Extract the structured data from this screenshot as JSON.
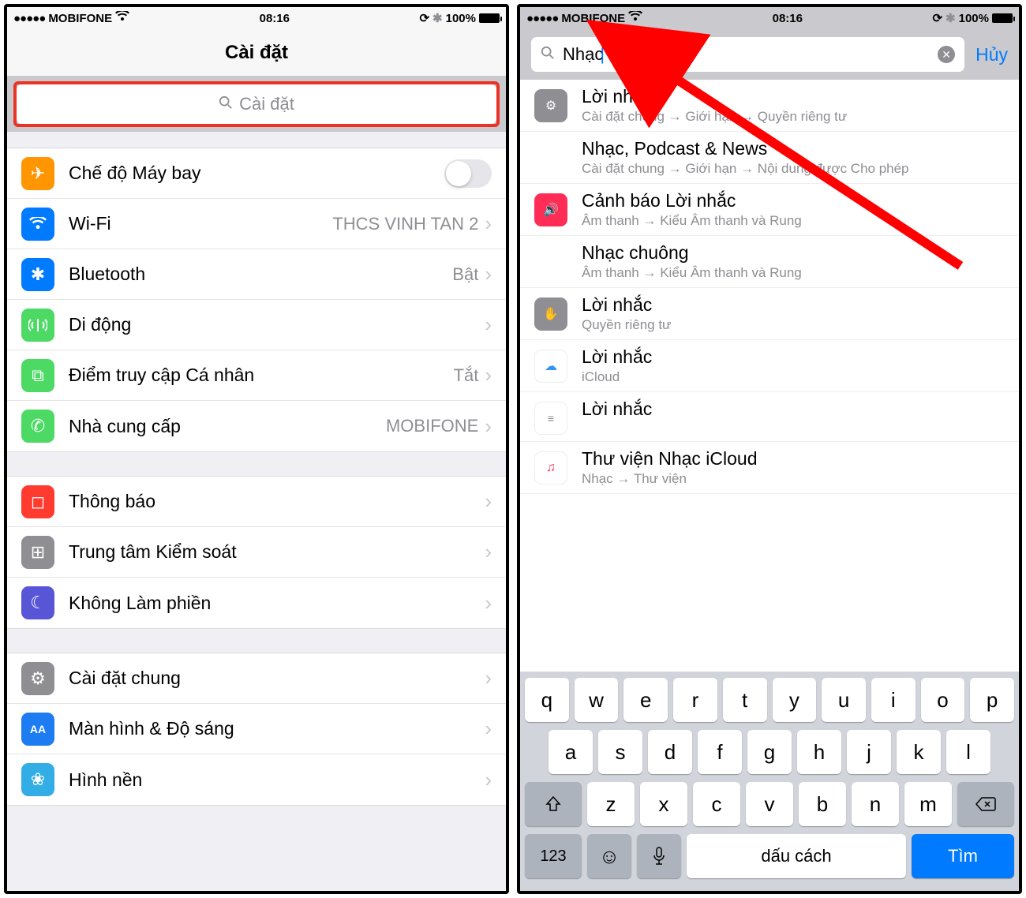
{
  "status": {
    "carrier": "MOBIFONE",
    "time": "08:16",
    "battery": "100%"
  },
  "left": {
    "title": "Cài đặt",
    "search_placeholder": "Cài đặt",
    "group1": [
      {
        "label": "Chế độ Máy bay",
        "value": "",
        "type": "toggle"
      },
      {
        "label": "Wi-Fi",
        "value": "THCS VINH TAN 2",
        "type": "link"
      },
      {
        "label": "Bluetooth",
        "value": "Bật",
        "type": "link"
      },
      {
        "label": "Di động",
        "value": "",
        "type": "link"
      },
      {
        "label": "Điểm truy cập Cá nhân",
        "value": "Tắt",
        "type": "link"
      },
      {
        "label": "Nhà cung cấp",
        "value": "MOBIFONE",
        "type": "link"
      }
    ],
    "group2": [
      {
        "label": "Thông báo"
      },
      {
        "label": "Trung tâm Kiểm soát"
      },
      {
        "label": "Không Làm phiền"
      }
    ],
    "group3": [
      {
        "label": "Cài đặt chung"
      },
      {
        "label": "Màn hình & Độ sáng"
      },
      {
        "label": "Hình nền"
      }
    ]
  },
  "right": {
    "search_value": "Nhạc",
    "cancel": "Hủy",
    "results": [
      {
        "title": "Lời nhắc",
        "path": "Cài đặt chung → Giới hạn → Quyền riêng tư",
        "icon": "gear"
      },
      {
        "title": "Nhạc, Podcast & News",
        "path": "Cài đặt chung → Giới hạn → Nội dung được Cho phép",
        "icon": "none"
      },
      {
        "title": "Cảnh báo Lời nhắc",
        "path": "Âm thanh → Kiểu Âm thanh và Rung",
        "icon": "sound"
      },
      {
        "title": "Nhạc chuông",
        "path": "Âm thanh → Kiểu Âm thanh và Rung",
        "icon": "none"
      },
      {
        "title": "Lời nhắc",
        "path": "Quyền riêng tư",
        "icon": "hand"
      },
      {
        "title": "Lời nhắc",
        "path": "iCloud",
        "icon": "cloud"
      },
      {
        "title": "Lời nhắc",
        "path": "",
        "icon": "list"
      },
      {
        "title": "Thư viện Nhạc iCloud",
        "path": "Nhạc → Thư viện",
        "icon": "music"
      }
    ],
    "keyboard": {
      "row1": [
        "q",
        "w",
        "e",
        "r",
        "t",
        "y",
        "u",
        "i",
        "o",
        "p"
      ],
      "row2": [
        "a",
        "s",
        "d",
        "f",
        "g",
        "h",
        "j",
        "k",
        "l"
      ],
      "row3": [
        "z",
        "x",
        "c",
        "v",
        "b",
        "n",
        "m"
      ],
      "num": "123",
      "space": "dấu cách",
      "return": "Tìm"
    }
  }
}
